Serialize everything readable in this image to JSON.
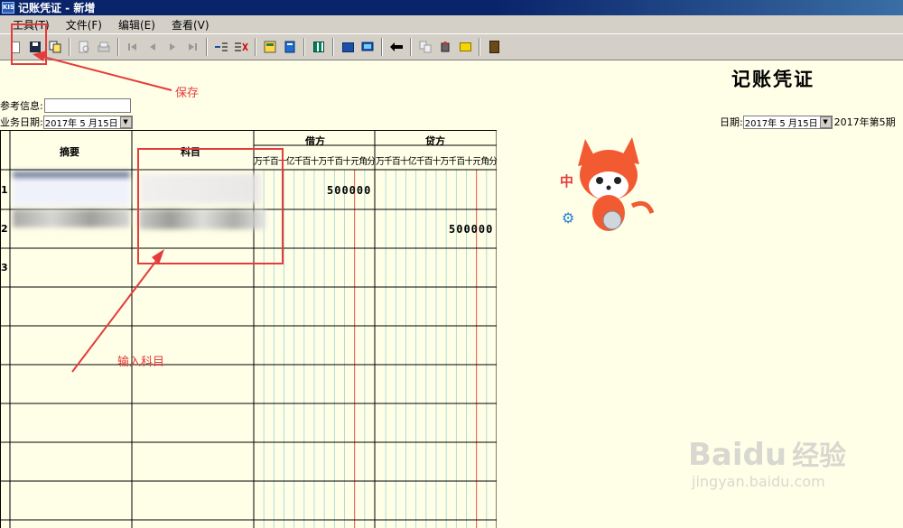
{
  "window": {
    "title": "记账凭证 - 新增",
    "icon_text": "KIS"
  },
  "menu": [
    "工具(T)",
    "文件(F)",
    "编辑(E)",
    "查看(V)"
  ],
  "toolbar": {
    "buttons": [
      "new-icon",
      "save-icon",
      "copy-icon",
      "preview-icon",
      "print-icon",
      "first-icon",
      "prev-icon",
      "next-icon",
      "last-icon",
      "insert-row-icon",
      "delete-row-icon",
      "calculator-icon",
      "voucher-icon",
      "grid-icon",
      "book-icon",
      "monitor-icon",
      "back-icon",
      "transfer-icon",
      "attach-icon",
      "mail-icon",
      "exit-icon"
    ]
  },
  "voucher": {
    "heading": "记账凭证",
    "ref_label": "参考信息:",
    "ref_value": "",
    "biz_date_label": "业务日期:",
    "biz_date_value": "2017年 5 月15日",
    "date_label": "日期:",
    "date_value": "2017年 5 月15日",
    "period": "2017年第5期"
  },
  "table": {
    "headers": {
      "summary": "摘要",
      "account": "科目",
      "debit": "借方",
      "credit": "贷方"
    },
    "digit_units": [
      "万",
      "千",
      "百",
      "十",
      "亿",
      "千",
      "百",
      "十",
      "万",
      "千",
      "百",
      "十",
      "元",
      "角",
      "分"
    ],
    "rows": [
      {
        "num": "1",
        "debit": "500000",
        "credit": ""
      },
      {
        "num": "2",
        "debit": "",
        "credit": "500000"
      },
      {
        "num": "3",
        "debit": "",
        "credit": ""
      }
    ]
  },
  "annotations": {
    "save_note": "保存",
    "account_note": "输入科目"
  },
  "mascot": {
    "badge_text": "中"
  },
  "watermark": {
    "brand": "Baidu",
    "brand_cn": "经验",
    "url": "jingyan.baidu.com"
  },
  "colors": {
    "background": "#ffffe8",
    "annotation": "#e53b3b",
    "titlebar": "#0a246a"
  }
}
